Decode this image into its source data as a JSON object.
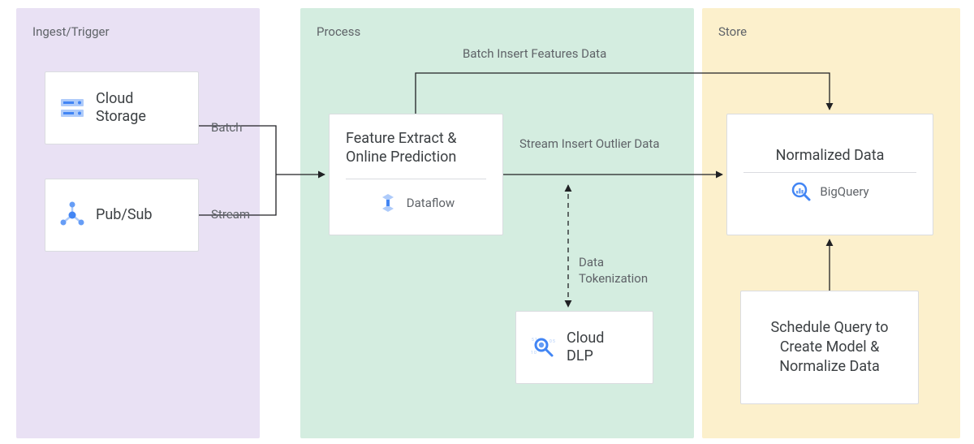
{
  "stages": {
    "ingest": {
      "label": "Ingest/Trigger"
    },
    "process": {
      "label": "Process"
    },
    "store": {
      "label": "Store"
    }
  },
  "nodes": {
    "storage": {
      "label": "Cloud\nStorage"
    },
    "pubsub": {
      "label": "Pub/Sub"
    },
    "process": {
      "title": "Feature Extract & Online Prediction",
      "service": "Dataflow"
    },
    "dlp": {
      "label": "Cloud\nDLP"
    },
    "store": {
      "title": "Normalized Data",
      "service": "BigQuery"
    },
    "schedule": {
      "label": "Schedule Query to Create Model & Normalize Data"
    }
  },
  "edges": {
    "batch": "Batch",
    "stream": "Stream",
    "batch_insert": "Batch Insert Features Data",
    "stream_insert": "Stream Insert Outlier Data",
    "tokenization": "Data Tokenization"
  },
  "colors": {
    "ingest_bg": "#e9e1f4",
    "process_bg": "#d4ede0",
    "store_bg": "#fcf0cc",
    "icon_blue": "#4285f4",
    "icon_light": "#aecbfa",
    "text": "#3c4043",
    "muted": "#5f6368",
    "line": "#202124"
  }
}
